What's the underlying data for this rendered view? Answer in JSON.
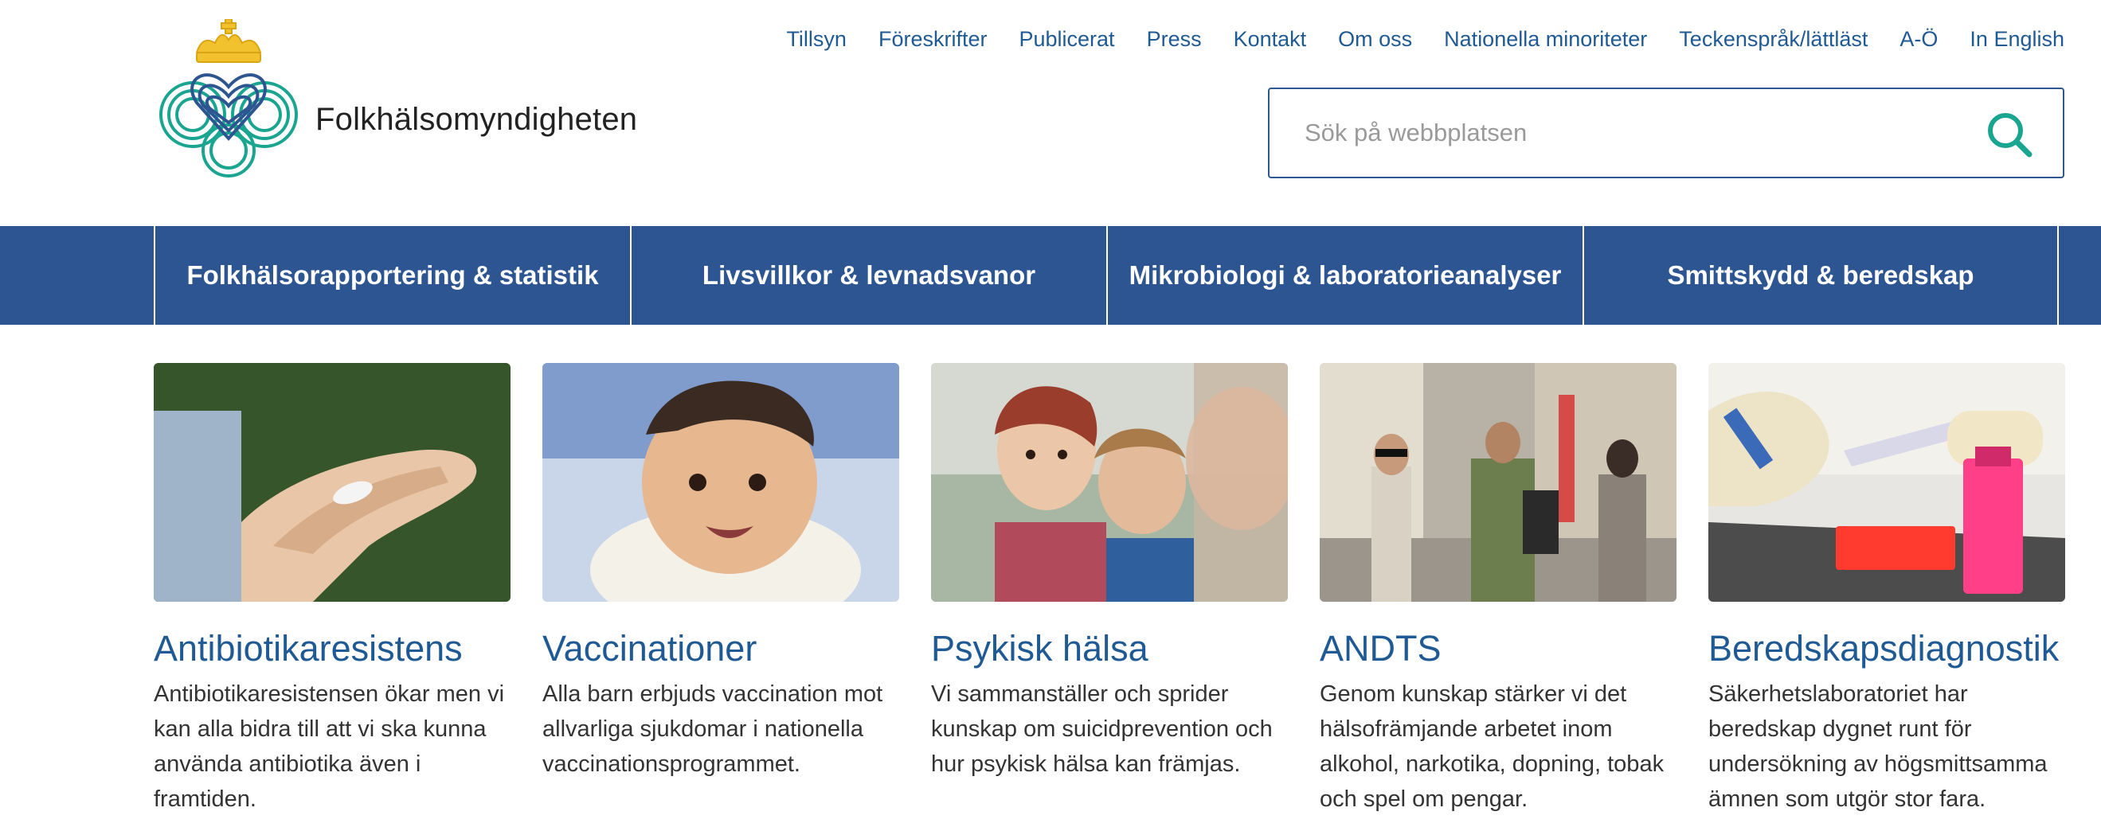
{
  "brand": {
    "name": "Folkhälsomyndigheten",
    "accent": "#2d5591",
    "link_color": "#1f5a94",
    "search_icon_color": "#1aa591"
  },
  "topnav": [
    "Tillsyn",
    "Föreskrifter",
    "Publicerat",
    "Press",
    "Kontakt",
    "Om oss",
    "Nationella minoriteter",
    "Teckenspråk/lättläst",
    "A-Ö",
    "In English"
  ],
  "search": {
    "placeholder": "Sök på webbplatsen",
    "value": "",
    "icon": "search-icon"
  },
  "mainnav": [
    "Folkhälsorapportering & statistik",
    "Livsvillkor & levnadsvanor",
    "Mikrobiologi & laboratorieanalyser",
    "Smittskydd & beredskap"
  ],
  "cards": [
    {
      "title": "Antibiotikaresistens",
      "text": "Antibiotikaresistensen ökar men vi kan alla bidra till att vi ska kunna använda antibiotika även i framtiden."
    },
    {
      "title": "Vaccinationer",
      "text": "Alla barn erbjuds vaccination mot allvarliga sjukdomar i nationella vaccinationsprogrammet."
    },
    {
      "title": "Psykisk hälsa",
      "text": "Vi sammanställer och sprider kunskap om suicidprevention och hur psykisk hälsa kan främjas."
    },
    {
      "title": "ANDTS",
      "text": "Genom kunskap stärker vi det hälsofrämjande arbetet inom alkohol, narkotika, dopning, tobak och spel om pengar."
    },
    {
      "title": "Beredskapsdiagnostik",
      "text": "Säkerhetslaboratoriet har beredskap dygnet runt för undersökning av högsmittsamma ämnen som utgör stor fara."
    }
  ]
}
